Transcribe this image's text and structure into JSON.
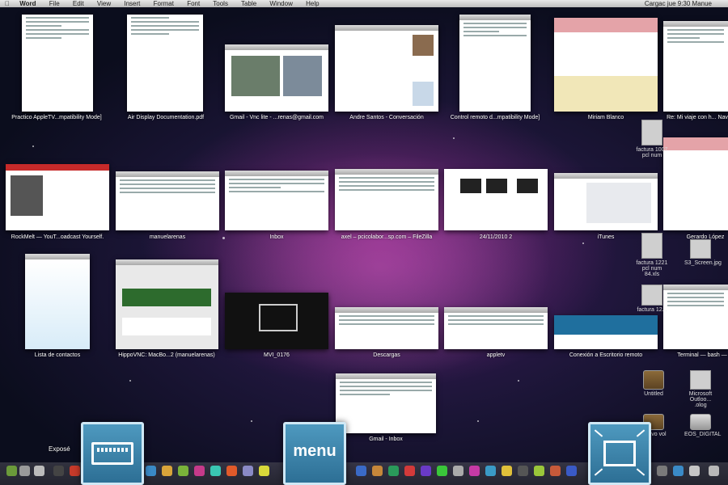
{
  "menubar": {
    "app_name": "Word",
    "items": [
      "File",
      "Edit",
      "View",
      "Insert",
      "Format",
      "Font",
      "Tools",
      "Table",
      "Window",
      "Help"
    ],
    "status_right": "Cargac   jue 9:30   Manue"
  },
  "windows_row1": [
    {
      "label": "Practico AppleTV...mpatibility Mode]"
    },
    {
      "label": "Air Display Documentation.pdf"
    },
    {
      "label": "Gmail - Vnc lite - ...renas@gmail.com"
    },
    {
      "label": "Andre Santos - Conversación"
    },
    {
      "label": "Control remoto d...mpatibility Mode]"
    },
    {
      "label": "Miriam Blanco"
    },
    {
      "label": "Re: Mi viaje con h... Nav"
    }
  ],
  "windows_row2": [
    {
      "label": "RockMelt — YouT...oadcast Yourself."
    },
    {
      "label": "manuelarenas"
    },
    {
      "label": "Inbox"
    },
    {
      "label": "axel – pcicolabor...sp.com – FileZilla"
    },
    {
      "label": "24/11/2010 2"
    },
    {
      "label": "iTunes"
    },
    {
      "label": "Gerardo López"
    }
  ],
  "windows_row3": [
    {
      "label": "Lista de contactos"
    },
    {
      "label": "HippoVNC: MacBo...2 (manuelarenas)"
    },
    {
      "label": "MVI_0176"
    },
    {
      "label": "Descargas"
    },
    {
      "label": "appletv"
    },
    {
      "label": "Conexión a Escritorio remoto"
    },
    {
      "label": "Terminal — bash —"
    }
  ],
  "windows_row4": [
    {
      "label": "Gmail - Inbox"
    }
  ],
  "desktop_icons": [
    {
      "label": "factura 1007 pcl num"
    },
    {
      "label": "factura 1221 pcl num 84.xls"
    },
    {
      "label": "S3_Screen.jpg"
    },
    {
      "label": "factura 12..."
    },
    {
      "label": "Untitled"
    },
    {
      "label": "Microsoft Outloo... .olog"
    },
    {
      "label": "Nuevo vol"
    },
    {
      "label": "EOS_DIGITAL"
    }
  ],
  "overlays": {
    "expose_tooltip": "Exposé",
    "menu_key_label": "menu"
  },
  "colors": {
    "overlay_blue": "#3a85ad",
    "overlay_border": "#cfe8f5",
    "menubar": "#d8d8d8"
  },
  "icons": [
    "apple-icon",
    "keyboard-icon",
    "expose-screen-icon",
    "dock-app-icon"
  ]
}
